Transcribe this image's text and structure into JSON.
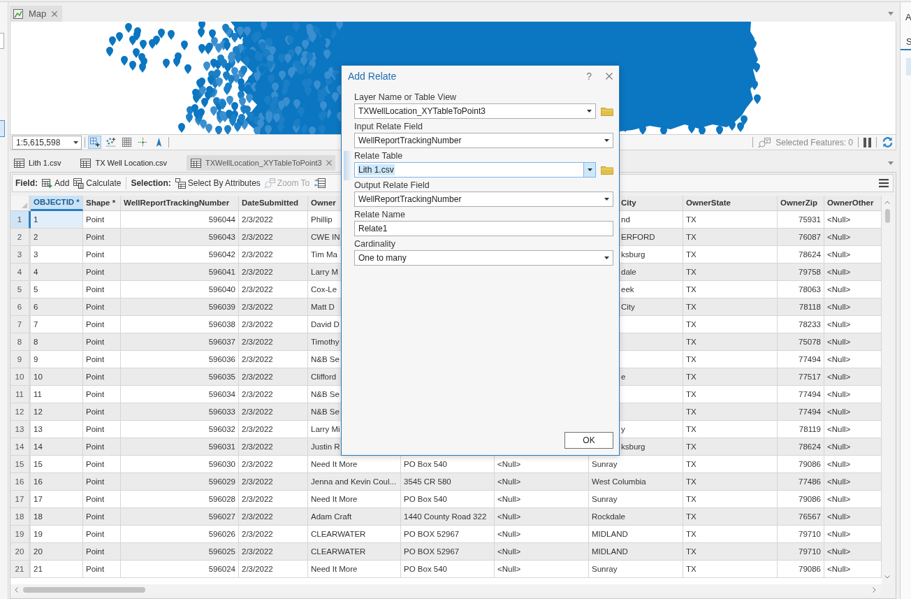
{
  "map_tab": {
    "label": "Map"
  },
  "map_bar": {
    "scale": "1:5,615,598",
    "tools": [
      {
        "selected": true
      },
      {
        "selected": false
      },
      {
        "selected": false
      },
      {
        "selected": false
      },
      {
        "selected": false
      }
    ],
    "selected_features": "Selected Features: 0"
  },
  "table_tabs": [
    {
      "label": "Lith 1.csv",
      "selected": false
    },
    {
      "label": "TX Well Location.csv",
      "selected": false
    },
    {
      "label": "TXWellLocation_XYTableToPoint3",
      "selected": true
    }
  ],
  "toolbar": {
    "groups": [
      {
        "label": "Field:",
        "buttons": [
          {
            "label": "Add",
            "disabled": false
          },
          {
            "label": "Calculate",
            "disabled": false
          }
        ]
      },
      {
        "label": "Selection:",
        "buttons": [
          {
            "label": "Select By Attributes",
            "disabled": false
          },
          {
            "label": "Zoom To",
            "disabled": true
          }
        ]
      }
    ]
  },
  "table": {
    "columns": [
      {
        "label": "OBJECTID *",
        "kind": "text",
        "selected": true
      },
      {
        "label": "Shape *",
        "kind": "text",
        "selected": false
      },
      {
        "label": "WellReportTrackingNumber",
        "kind": "number",
        "selected": false
      },
      {
        "label": "DateSubmitted",
        "kind": "text",
        "selected": false
      },
      {
        "label": "Owner",
        "kind": "text",
        "selected": false
      },
      {
        "kind": "text"
      },
      {
        "kind": "text"
      },
      {
        "label": "City",
        "kind": "text",
        "selected": false
      },
      {
        "label": "OwnerState",
        "kind": "text",
        "selected": false
      },
      {
        "label": "OwnerZip",
        "kind": "number",
        "selected": false
      },
      {
        "label": "OwnerOther",
        "kind": "text",
        "selected": false
      }
    ],
    "rows": [
      {
        "number": "1",
        "selected": true,
        "cells": [
          "1",
          "Point",
          "596044",
          "2/3/2022",
          "Phillip",
          null,
          null,
          "nd",
          "TX",
          "75931",
          "<Null>"
        ]
      },
      {
        "number": "2",
        "selected": false,
        "cells": [
          "2",
          "Point",
          "596043",
          "2/3/2022",
          "CWE IN",
          null,
          null,
          "ERFORD",
          "TX",
          "76087",
          "<Null>"
        ]
      },
      {
        "number": "3",
        "selected": false,
        "cells": [
          "3",
          "Point",
          "596042",
          "2/3/2022",
          "Tim Ma",
          null,
          null,
          "ksburg",
          "TX",
          "78624",
          "<Null>"
        ]
      },
      {
        "number": "4",
        "selected": false,
        "cells": [
          "4",
          "Point",
          "596041",
          "2/3/2022",
          "Larry M",
          null,
          null,
          "dale",
          "TX",
          "79758",
          "<Null>"
        ]
      },
      {
        "number": "5",
        "selected": false,
        "cells": [
          "5",
          "Point",
          "596040",
          "2/3/2022",
          "Cox-Le",
          null,
          null,
          "eek",
          "TX",
          "78063",
          "<Null>"
        ]
      },
      {
        "number": "6",
        "selected": false,
        "cells": [
          "6",
          "Point",
          "596039",
          "2/3/2022",
          "Matt D",
          null,
          null,
          "City",
          "TX",
          "78118",
          "<Null>"
        ]
      },
      {
        "number": "7",
        "selected": false,
        "cells": [
          "7",
          "Point",
          "596038",
          "2/3/2022",
          "David D",
          null,
          null,
          null,
          "TX",
          "78233",
          "<Null>"
        ]
      },
      {
        "number": "8",
        "selected": false,
        "cells": [
          "8",
          "Point",
          "596037",
          "2/3/2022",
          "Timothy",
          null,
          null,
          null,
          "TX",
          "75078",
          "<Null>"
        ]
      },
      {
        "number": "9",
        "selected": false,
        "cells": [
          "9",
          "Point",
          "596036",
          "2/3/2022",
          "N&B Se",
          null,
          null,
          null,
          "TX",
          "77494",
          "<Null>"
        ]
      },
      {
        "number": "10",
        "selected": false,
        "cells": [
          "10",
          "Point",
          "596035",
          "2/3/2022",
          "Clifford",
          null,
          null,
          "e",
          "TX",
          "77517",
          "<Null>"
        ]
      },
      {
        "number": "11",
        "selected": false,
        "cells": [
          "11",
          "Point",
          "596034",
          "2/3/2022",
          "N&B Se",
          null,
          null,
          null,
          "TX",
          "77494",
          "<Null>"
        ]
      },
      {
        "number": "12",
        "selected": false,
        "cells": [
          "12",
          "Point",
          "596033",
          "2/3/2022",
          "N&B Se",
          null,
          null,
          null,
          "TX",
          "77494",
          "<Null>"
        ]
      },
      {
        "number": "13",
        "selected": false,
        "cells": [
          "13",
          "Point",
          "596032",
          "2/3/2022",
          "Larry Mi",
          null,
          null,
          "y",
          "TX",
          "78119",
          "<Null>"
        ]
      },
      {
        "number": "14",
        "selected": false,
        "cells": [
          "14",
          "Point",
          "596031",
          "2/3/2022",
          "Justin R",
          null,
          null,
          "ksburg",
          "TX",
          "78624",
          "<Null>"
        ]
      },
      {
        "number": "15",
        "selected": false,
        "cells": [
          "15",
          "Point",
          "596030",
          "2/3/2022",
          "Need It More",
          "PO Box 540",
          "<Null>",
          "Sunray",
          "TX",
          "79086",
          "<Null>"
        ]
      },
      {
        "number": "16",
        "selected": false,
        "cells": [
          "16",
          "Point",
          "596029",
          "2/3/2022",
          "Jenna and Kevin Coul...",
          "3545 CR 580",
          "<Null>",
          "West Columbia",
          "TX",
          "77486",
          "<Null>"
        ]
      },
      {
        "number": "17",
        "selected": false,
        "cells": [
          "17",
          "Point",
          "596028",
          "2/3/2022",
          "Need It More",
          "PO Box 540",
          "<Null>",
          "Sunray",
          "TX",
          "79086",
          "<Null>"
        ]
      },
      {
        "number": "18",
        "selected": false,
        "cells": [
          "18",
          "Point",
          "596027",
          "2/3/2022",
          "Adam Craft",
          "1440 County Road 322",
          "<Null>",
          "Rockdale",
          "TX",
          "76567",
          "<Null>"
        ]
      },
      {
        "number": "19",
        "selected": false,
        "cells": [
          "19",
          "Point",
          "596026",
          "2/3/2022",
          "CLEARWATER",
          "PO BOX 52967",
          "<Null>",
          "MIDLAND",
          "TX",
          "79710",
          "<Null>"
        ]
      },
      {
        "number": "20",
        "selected": false,
        "cells": [
          "20",
          "Point",
          "596025",
          "2/3/2022",
          "CLEARWATER",
          "PO BOX 52967",
          "<Null>",
          "MIDLAND",
          "TX",
          "79710",
          "<Null>"
        ]
      },
      {
        "number": "21",
        "selected": false,
        "cells": [
          "21",
          "Point",
          "596024",
          "2/3/2022",
          "Need It More",
          "PO Box 540",
          "<Null>",
          "Sunray",
          "TX",
          "79086",
          "<Null>"
        ]
      }
    ]
  },
  "dialog": {
    "title": "Add Relate",
    "help": "?",
    "fields": [
      {
        "label": "Layer Name or Table View",
        "kind": "combo",
        "value": "TXWellLocation_XYTableToPoint3",
        "browse": true,
        "focused": false
      },
      {
        "label": "Input Relate Field",
        "kind": "combo",
        "value": "WellReportTrackingNumber",
        "browse": false,
        "focused": false
      },
      {
        "label": "Relate Table",
        "kind": "combo",
        "value": "Lith 1.csv",
        "browse": true,
        "focused": true
      },
      {
        "label": "Output Relate Field",
        "kind": "combo",
        "value": "WellReportTrackingNumber",
        "browse": false,
        "focused": false
      },
      {
        "label": "Relate Name",
        "kind": "text",
        "value": "Relate1",
        "browse": false,
        "focused": false
      },
      {
        "label": "Cardinality",
        "kind": "combo",
        "value": "One to many",
        "browse": false,
        "focused": false
      }
    ],
    "buttons": [
      "OK"
    ]
  },
  "right_pane": {
    "title": "A",
    "tabs": [
      {
        "label": "S",
        "selected": true
      }
    ]
  }
}
